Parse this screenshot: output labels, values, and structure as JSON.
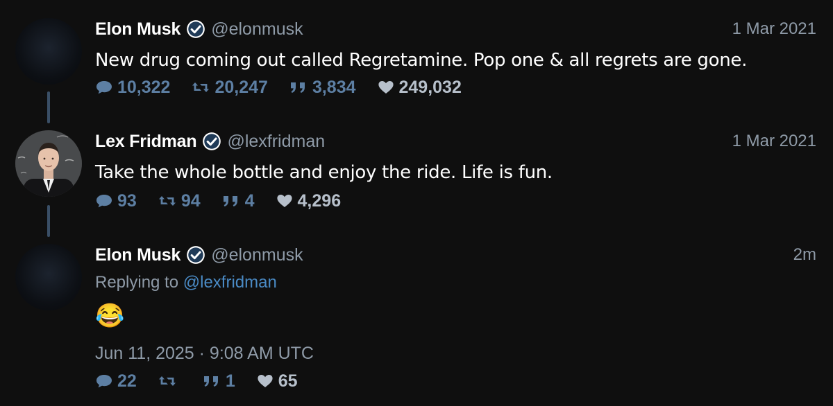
{
  "tweets": [
    {
      "name": "Elon Musk",
      "handle": "@elonmusk",
      "date": "1 Mar 2021",
      "text": "New drug coming out called Regretamine. Pop one & all regrets are gone.",
      "stats": {
        "replies": "10,322",
        "retweets": "20,247",
        "quotes": "3,834",
        "likes": "249,032"
      }
    },
    {
      "name": "Lex Fridman",
      "handle": "@lexfridman",
      "date": "1 Mar 2021",
      "text": "Take the whole bottle and enjoy the ride. Life is fun.",
      "stats": {
        "replies": "93",
        "retweets": "94",
        "quotes": "4",
        "likes": "4,296"
      }
    },
    {
      "name": "Elon Musk",
      "handle": "@elonmusk",
      "date": "2m",
      "replying_label": "Replying to",
      "replying_to": "@lexfridman",
      "text": "😂",
      "timestamp": "Jun 11, 2025 · 9:08 AM UTC",
      "stats": {
        "replies": "22",
        "retweets": "",
        "quotes": "1",
        "likes": "65"
      }
    }
  ],
  "colors": {
    "background": "#0f0f0f",
    "accent": "#5d7fa3",
    "muted": "#8f9ba8",
    "thread_line": "#3a4f66"
  },
  "icons": [
    "verified-badge-icon",
    "reply-icon",
    "retweet-icon",
    "quote-icon",
    "like-icon"
  ]
}
